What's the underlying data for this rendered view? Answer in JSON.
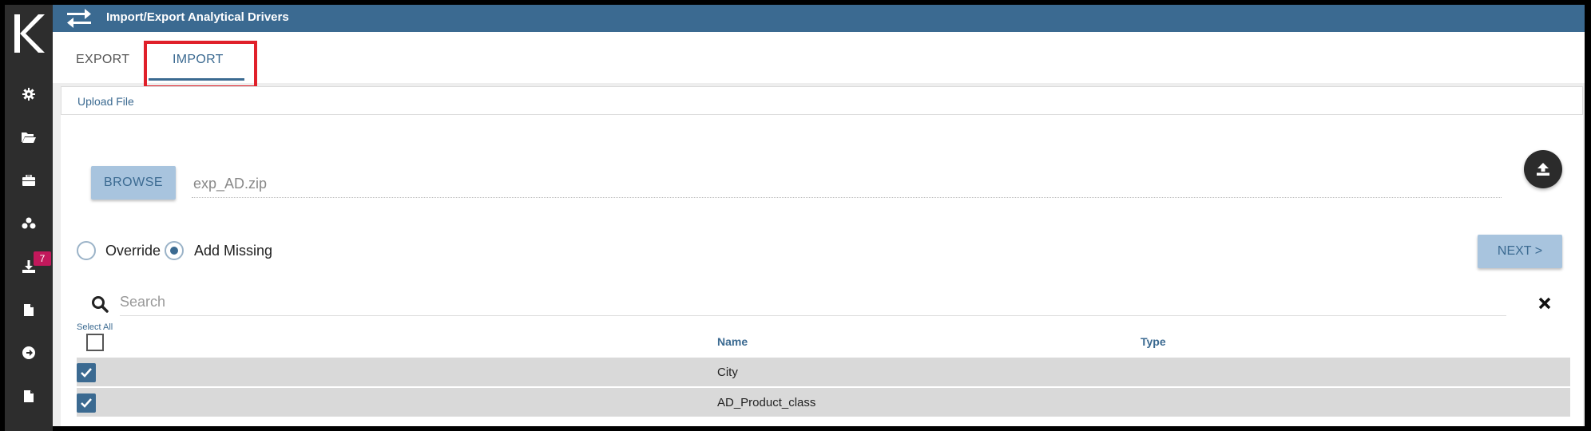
{
  "app": {
    "title": "Import/Export Analytical Drivers",
    "logo": "K",
    "accent_color": "#3b6a91",
    "highlight_color": "#e0202a"
  },
  "sidebar": {
    "items": [
      {
        "icon": "gear-icon"
      },
      {
        "icon": "folder-open-icon"
      },
      {
        "icon": "briefcase-icon"
      },
      {
        "icon": "cubes-icon"
      },
      {
        "icon": "download-icon",
        "badge": "7"
      },
      {
        "icon": "document-icon"
      },
      {
        "icon": "arrow-circle-right-icon"
      },
      {
        "icon": "document-icon"
      }
    ]
  },
  "tabs": [
    {
      "label": "EXPORT",
      "active": false
    },
    {
      "label": "IMPORT",
      "active": true
    }
  ],
  "upload": {
    "section_label": "Upload File",
    "browse_label": "BROWSE",
    "file_name": "exp_AD.zip"
  },
  "options": {
    "override_label": "Override",
    "add_missing_label": "Add Missing",
    "selected": "Add Missing"
  },
  "next_label": "NEXT >",
  "search": {
    "placeholder": "Search"
  },
  "table": {
    "select_all_label": "Select All",
    "columns": [
      "Name",
      "Type"
    ],
    "rows": [
      {
        "name": "City",
        "type": "",
        "checked": true
      },
      {
        "name": "AD_Product_class",
        "type": "",
        "checked": true
      }
    ]
  }
}
